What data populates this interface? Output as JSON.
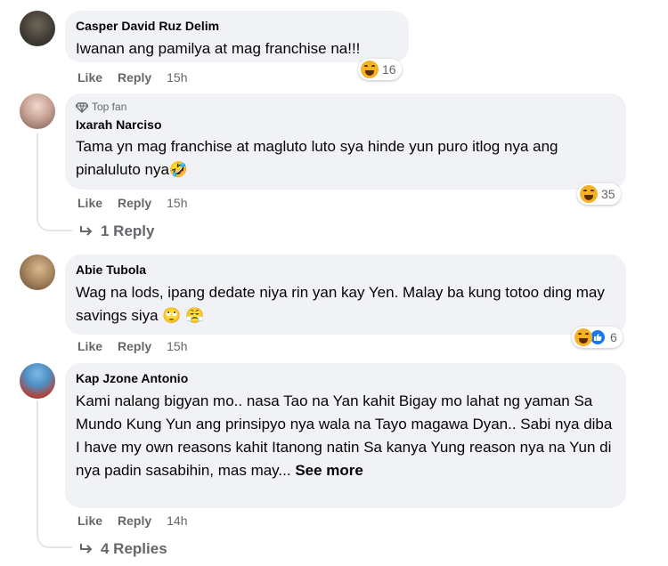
{
  "comments": [
    {
      "author": "Casper David Ruz Delim",
      "text": "Iwanan ang pamilya at mag franchise na!!!",
      "like": "Like",
      "reply": "Reply",
      "time": "15h",
      "reaction_count": "16"
    },
    {
      "badge": "Top fan",
      "author": "Ixarah Narciso",
      "text": "Tama yn mag franchise at magluto luto sya hinde yun puro itlog nya ang pinaluluto nya🤣",
      "like": "Like",
      "reply": "Reply",
      "time": "15h",
      "reaction_count": "35",
      "replies_label": "1 Reply"
    },
    {
      "author": "Abie Tubola",
      "text": "Wag na lods, ipang dedate niya rin yan kay Yen. Malay ba kung totoo ding may savings siya 🙄 😤",
      "like": "Like",
      "reply": "Reply",
      "time": "15h",
      "reaction_count": "6"
    },
    {
      "author": "Kap Jzone Antonio",
      "text": "Kami nalang bigyan mo.. nasa Tao na Yan kahit Bigay mo lahat ng yaman Sa Mundo Kung Yun ang prinsipyo nya wala na Tayo magawa Dyan.. Sabi nya diba I have my own reasons kahit Itanong natin Sa kanya Yung reason nya na Yun di nya padin sasabihin, mas may...",
      "see_more": "See more",
      "like": "Like",
      "reply": "Reply",
      "time": "14h",
      "replies_label": "4 Replies"
    }
  ],
  "colors": {
    "bubble": "#f0f2f5",
    "secondary_text": "#65676b",
    "reaction_haha": "#f7b125",
    "reaction_like": "#1877f2"
  },
  "icons": [
    "haha-icon",
    "like-icon",
    "diamond-icon",
    "reply-arrow-icon"
  ]
}
